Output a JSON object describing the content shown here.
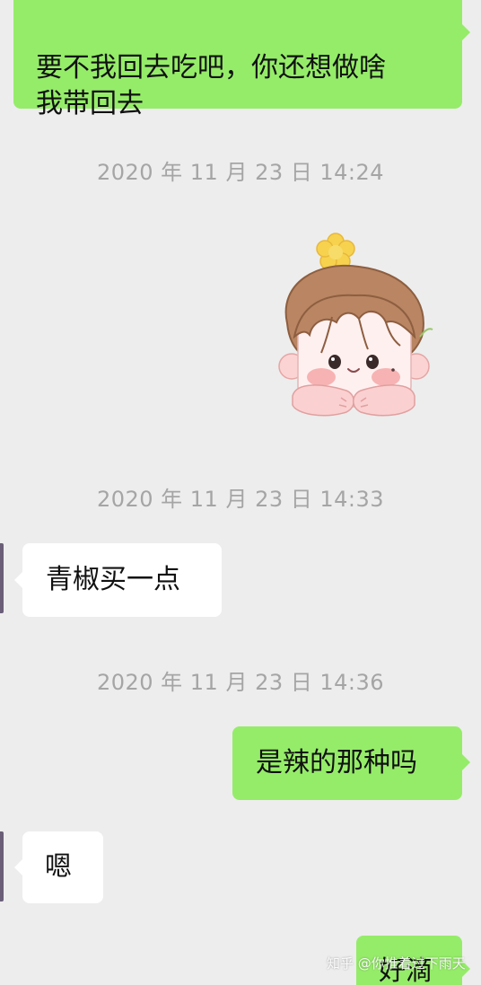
{
  "messages": {
    "m1": "要不我回去吃吧，你还想做啥\n我带回去",
    "m2": "青椒买一点",
    "m3": "是辣的那种吗",
    "m4": "嗯",
    "m5": "好滴"
  },
  "timestamps": {
    "t1": "2020 年 11 月 23 日 14:24",
    "t2": "2020 年 11 月 23 日 14:33",
    "t3": "2020 年 11 月 23 日 14:36"
  },
  "sticker": {
    "icon": "chibi-boy-sticker-icon"
  },
  "watermark": "知乎 @你推着过下雨天",
  "colors": {
    "background": "#ededed",
    "self_bubble": "#95ec69",
    "other_bubble": "#ffffff",
    "timestamp_text": "#a5a5a5"
  }
}
